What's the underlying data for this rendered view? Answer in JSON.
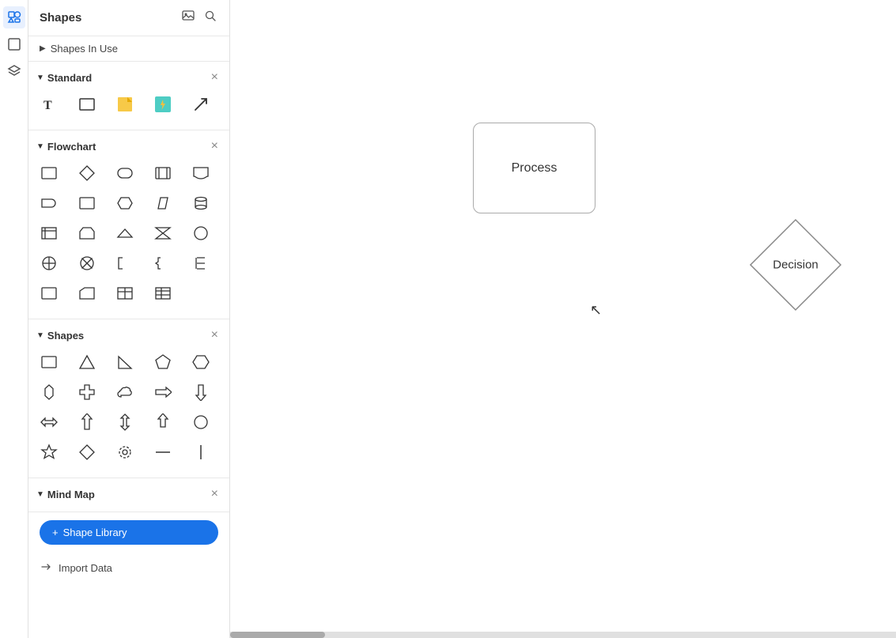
{
  "panel": {
    "title": "Shapes",
    "shapes_in_use": "Shapes In Use",
    "sections": [
      {
        "id": "standard",
        "label": "Standard",
        "shapes": [
          "T",
          "▭",
          "★",
          "⚡",
          "↗"
        ]
      },
      {
        "id": "flowchart",
        "label": "Flowchart",
        "shapes": [
          "rect",
          "diamond",
          "stadium",
          "rect2",
          "doc",
          "delay",
          "rect3",
          "rect4",
          "hex",
          "para",
          "cyl",
          "rect5",
          "rect6",
          "trapez",
          "trapez2",
          "rect7",
          "inv-tri",
          "circle",
          "cross-circ",
          "x-circ",
          "rect8",
          "tri",
          "curly1",
          "curly2",
          "curly3",
          "table1",
          "table2"
        ]
      },
      {
        "id": "shapes",
        "label": "Shapes",
        "shapes": [
          "rect",
          "tri",
          "r-tri",
          "penta",
          "hex",
          "hex2",
          "plus",
          "cloud",
          "arrow-r",
          "arrow-d",
          "dbl-arrow-h",
          "arrow-u",
          "dbl-arrow-v",
          "arrow-v",
          "circle",
          "star",
          "diamond2",
          "gear",
          "line-h",
          "line-v"
        ]
      },
      {
        "id": "mindmap",
        "label": "Mind Map"
      }
    ]
  },
  "shape_library": {
    "button_label": "Shape Library",
    "plus_icon": "+"
  },
  "import_data": {
    "label": "Import Data",
    "icon": "→"
  },
  "canvas": {
    "process_label": "Process",
    "decision_label": "Decision"
  },
  "icons": {
    "image": "🖼",
    "search": "🔍",
    "arrow_right": "▶",
    "arrow_down": "▼",
    "close": "×",
    "shapes_tool": "⬡",
    "page_tool": "⬜",
    "layers_tool": "⬛"
  }
}
